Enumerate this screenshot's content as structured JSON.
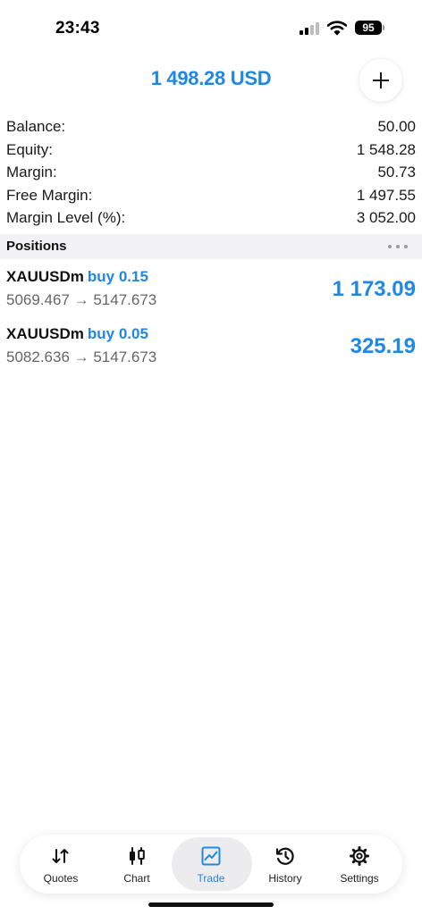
{
  "status_bar": {
    "time": "23:43",
    "battery": "95",
    "icons": [
      "signal-icon",
      "wifi-icon",
      "battery-icon"
    ]
  },
  "header": {
    "title": "1 498.28 USD",
    "add_button_icon": "plus-icon"
  },
  "summary": [
    {
      "label": "Balance:",
      "value": "50.00"
    },
    {
      "label": "Equity:",
      "value": "1 548.28"
    },
    {
      "label": "Margin:",
      "value": "50.73"
    },
    {
      "label": "Free Margin:",
      "value": "1 497.55"
    },
    {
      "label": "Margin Level (%):",
      "value": "3 052.00"
    }
  ],
  "positions": {
    "title": "Positions",
    "more_icon": "more-horizontal-icon",
    "items": [
      {
        "symbol": "XAUUSDm",
        "side": "buy 0.15",
        "prices": "5069.467 → 5147.673",
        "profit": "1 173.09"
      },
      {
        "symbol": "XAUUSDm",
        "side": "buy 0.05",
        "prices": "5082.636 → 5147.673",
        "profit": "325.19"
      }
    ]
  },
  "tabs": [
    {
      "label": "Quotes",
      "icon": "quotes-icon",
      "active": false
    },
    {
      "label": "Chart",
      "icon": "chart-icon",
      "active": false
    },
    {
      "label": "Trade",
      "icon": "trade-icon",
      "active": true
    },
    {
      "label": "History",
      "icon": "history-icon",
      "active": false
    },
    {
      "label": "Settings",
      "icon": "settings-icon",
      "active": false
    }
  ],
  "colors": {
    "accent": "#1e88e5",
    "text": "#1a1a1a",
    "secondary_text": "#666666",
    "section_background": "#f2f2f4"
  }
}
